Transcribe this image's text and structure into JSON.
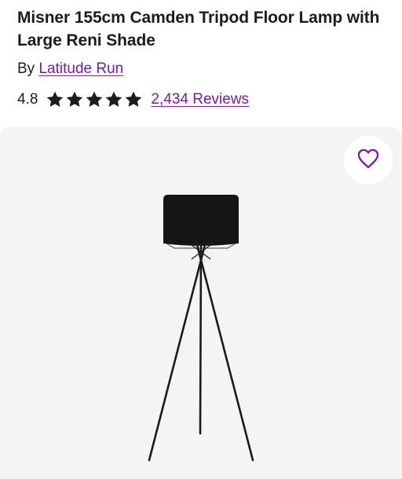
{
  "product": {
    "title": "Misner 155cm Camden Tripod Floor Lamp with Large Reni Shade",
    "by_prefix": "By",
    "brand": "Latitude Run",
    "rating": "4.8",
    "stars": 5,
    "reviews": "2,434 Reviews"
  },
  "icons": {
    "star": "star-icon",
    "favorite": "heart-outline-icon"
  },
  "colors": {
    "link": "#7b189f",
    "heart": "#7b189f",
    "gallery_bg": "#f4f4f4"
  }
}
